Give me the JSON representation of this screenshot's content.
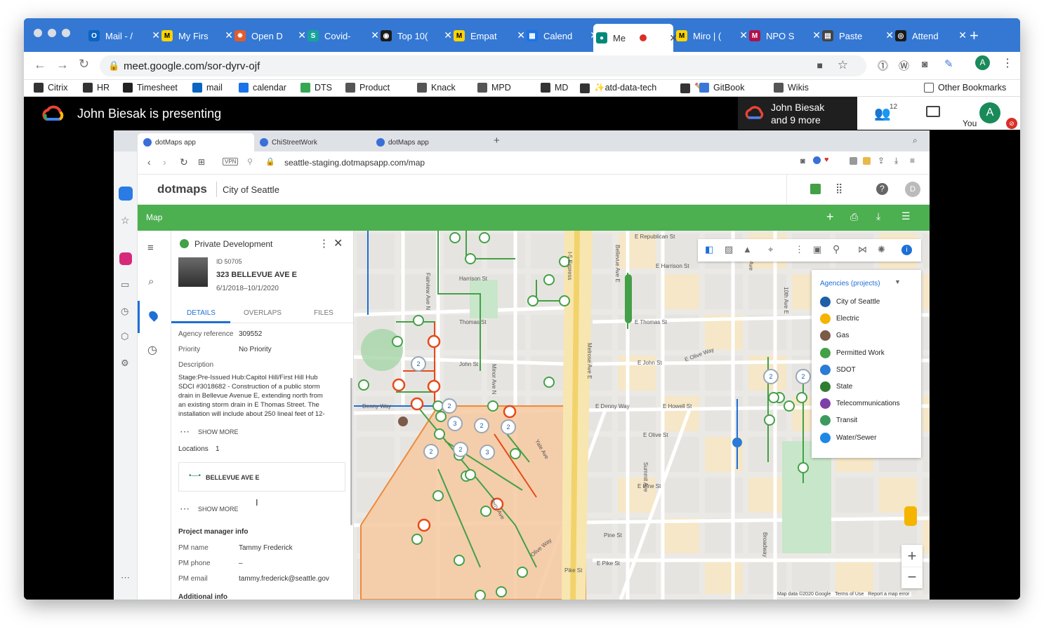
{
  "browser": {
    "tabs": [
      {
        "label": "Mail - /",
        "color": "#0a64c2",
        "glyph": "O"
      },
      {
        "label": "My Firs",
        "color": "#ffd400",
        "glyph": "M"
      },
      {
        "label": "Open D",
        "color": "#e25b2a",
        "glyph": "✸"
      },
      {
        "label": "Covid-",
        "color": "#18a39a",
        "glyph": "S"
      },
      {
        "label": "Top 10(",
        "color": "#1a1a1a",
        "glyph": "◉"
      },
      {
        "label": "Empat",
        "color": "#ffd400",
        "glyph": "M"
      },
      {
        "label": "Calend",
        "color": "#1a73e8",
        "glyph": "▦"
      },
      {
        "label": "Me",
        "color": "#00897b",
        "glyph": "●"
      },
      {
        "label": "Miro | (",
        "color": "#ffd400",
        "glyph": "M"
      },
      {
        "label": "NPO S",
        "color": "#b0124a",
        "glyph": "M"
      },
      {
        "label": "Paste",
        "color": "#444",
        "glyph": "▤"
      },
      {
        "label": "Attend",
        "color": "#1a1a1a",
        "glyph": "◎"
      }
    ],
    "url": "meet.google.com/sor-dyrv-ojf",
    "profile_initial": "A",
    "bookmarks": [
      "Citrix",
      "HR",
      "Timesheet",
      "mail",
      "calendar",
      "DTS",
      "Product",
      "Knack",
      "MPD",
      "MD",
      "✨atd-data-tech",
      "✏️",
      "GitBook",
      "Wikis"
    ],
    "other_bookmarks": "Other Bookmarks"
  },
  "meet": {
    "presenting": "John Biesak is presenting",
    "presenter_line1": "John Biesak",
    "presenter_line2": "and 9 more",
    "people_count": "12",
    "you_label": "You",
    "you_initial": "A"
  },
  "inner": {
    "tabs": [
      "dotMaps app",
      "ChiStreetWork",
      "dotMaps app"
    ],
    "vpn": "VPN",
    "url": "seattle-staging.dotmapsapp.com/map",
    "logo": "dotmaps",
    "city": "City of Seattle",
    "user_initial": "D",
    "bar_title": "Map"
  },
  "panel": {
    "type": "Private Development",
    "id": "ID 50705",
    "address": "323 BELLEVUE AVE E",
    "dates": "6/1/2018–10/1/2020",
    "tabs": [
      "DETAILS",
      "OVERLAPS",
      "FILES"
    ],
    "agency_ref_label": "Agency reference",
    "agency_ref": "309552",
    "priority_label": "Priority",
    "priority": "No Priority",
    "desc_label": "Description",
    "desc_lines": [
      "Stage:Pre-Issued Hub:Capitol Hill/First Hill Hub",
      "SDCI #3018682 - Construction of a public storm",
      "drain in Bellevue Avenue E, extending north from",
      "an existing storm drain in E Thomas Street. The",
      "installation will include about 250 lineal feet of 12-"
    ],
    "show_more": "SHOW MORE",
    "locations_label": "Locations",
    "locations_count": "1",
    "location": "BELLEVUE AVE E",
    "pm_header": "Project manager info",
    "pm_name_label": "PM name",
    "pm_name": "Tammy Frederick",
    "pm_phone_label": "PM phone",
    "pm_phone": "–",
    "pm_email_label": "PM email",
    "pm_email": "tammy.frederick@seattle.gov",
    "additional": "Additional info"
  },
  "map": {
    "legend_title": "Agencies (projects)",
    "legend": [
      {
        "label": "City of Seattle",
        "color": "#1e5fa8"
      },
      {
        "label": "Electric",
        "color": "#f5b400"
      },
      {
        "label": "Gas",
        "color": "#7b5a4a"
      },
      {
        "label": "Permitted Work",
        "color": "#43a047"
      },
      {
        "label": "SDOT",
        "color": "#2b7bd6"
      },
      {
        "label": "State",
        "color": "#2e7d32"
      },
      {
        "label": "Telecommunications",
        "color": "#7e3fa8"
      },
      {
        "label": "Transit",
        "color": "#3d9a5f"
      },
      {
        "label": "Water/Sewer",
        "color": "#1e88e5"
      }
    ],
    "streets": [
      "E Republican St",
      "E Harrison St",
      "Harrison St",
      "Thomas St",
      "John St",
      "E John St",
      "E Thomas St",
      "E Olive Way",
      "Denny Way",
      "E Denny Way",
      "E Howell St",
      "E Olive St",
      "E Pine St",
      "Pine St",
      "E Pike St",
      "Pike St",
      "Olive Way",
      "Yale Ave",
      "Terry Ave",
      "I-5 Express",
      "Bellevue Ave E",
      "Melrose Ave E",
      "Fairview Ave N",
      "Minor Ave N",
      "Broadway",
      "10th Ave E",
      "Summit Ave",
      "Boren Ave"
    ],
    "cluster_labels": [
      "2",
      "2",
      "3",
      "2",
      "2",
      "2",
      "2",
      "3",
      "2",
      "2"
    ],
    "attribution": "Map data ©2020 Google",
    "terms": "Terms of Use",
    "report": "Report a map error"
  }
}
